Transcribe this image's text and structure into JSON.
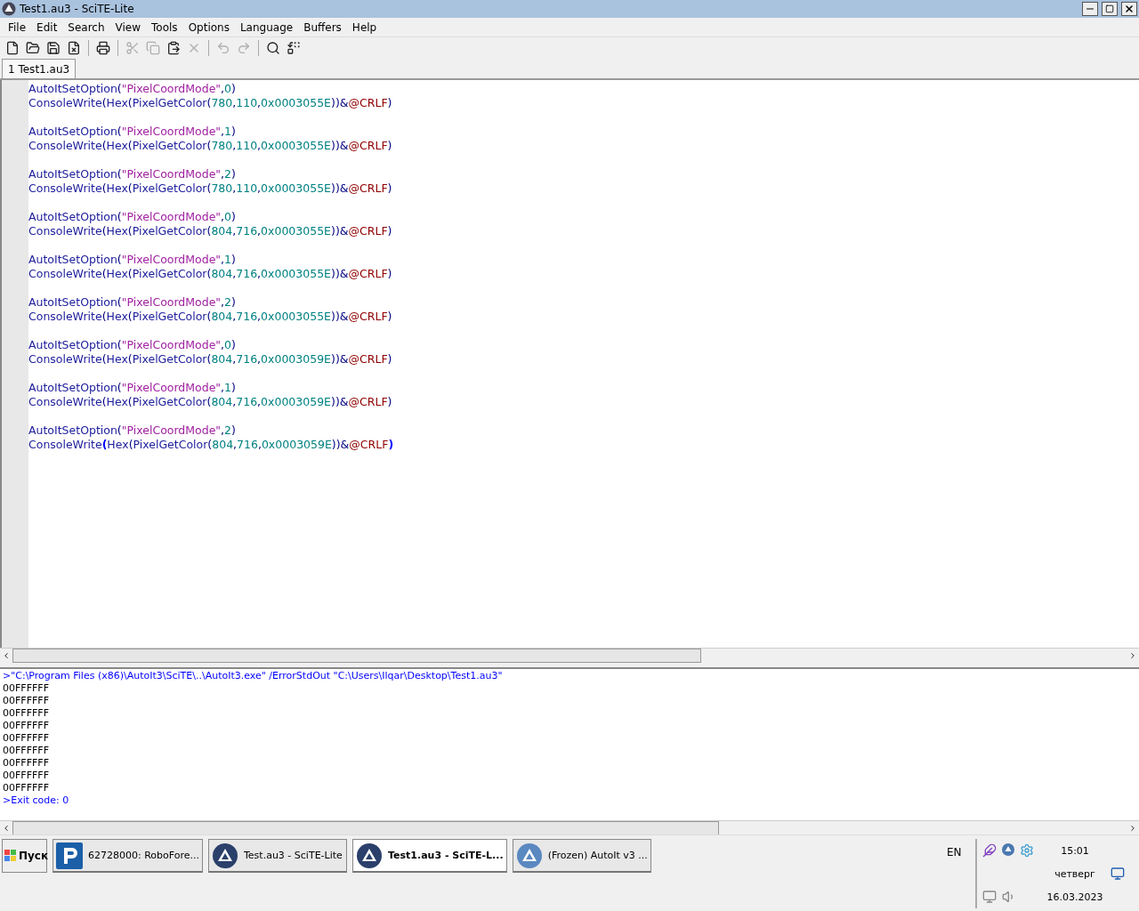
{
  "window": {
    "title": "Test1.au3 - SciTE-Lite"
  },
  "menu": [
    "File",
    "Edit",
    "Search",
    "View",
    "Tools",
    "Options",
    "Language",
    "Buffers",
    "Help"
  ],
  "toolbar": [
    {
      "kind": "new",
      "disabled": false
    },
    {
      "kind": "open",
      "disabled": false
    },
    {
      "kind": "save",
      "disabled": false
    },
    {
      "kind": "close",
      "disabled": false
    },
    {
      "kind": "sep"
    },
    {
      "kind": "print",
      "disabled": false
    },
    {
      "kind": "sep"
    },
    {
      "kind": "cut",
      "disabled": true
    },
    {
      "kind": "copy",
      "disabled": true
    },
    {
      "kind": "paste",
      "disabled": false
    },
    {
      "kind": "delete",
      "disabled": true
    },
    {
      "kind": "sep"
    },
    {
      "kind": "undo",
      "disabled": true
    },
    {
      "kind": "redo",
      "disabled": true
    },
    {
      "kind": "sep"
    },
    {
      "kind": "find",
      "disabled": false
    },
    {
      "kind": "replace",
      "disabled": false
    }
  ],
  "tabs": [
    {
      "label": "1 Test1.au3",
      "selected": true
    }
  ],
  "editor": {
    "blocks": [
      {
        "lines": [
          [
            {
              "text": "AutoItSetOption",
              "kind": "func"
            },
            {
              "text": "(",
              "kind": "op"
            },
            {
              "text": "\"PixelCoordMode\"",
              "kind": "string"
            },
            {
              "text": ",",
              "kind": "op"
            },
            {
              "text": "0",
              "kind": "number"
            },
            {
              "text": ")",
              "kind": "op"
            }
          ],
          [
            {
              "text": "ConsoleWrite",
              "kind": "func"
            },
            {
              "text": "(",
              "kind": "op"
            },
            {
              "text": "Hex",
              "kind": "func"
            },
            {
              "text": "(",
              "kind": "op"
            },
            {
              "text": "PixelGetColor",
              "kind": "func"
            },
            {
              "text": "(",
              "kind": "op"
            },
            {
              "text": "780",
              "kind": "number"
            },
            {
              "text": ",",
              "kind": "op"
            },
            {
              "text": "110",
              "kind": "number"
            },
            {
              "text": ",",
              "kind": "op"
            },
            {
              "text": "0x0003055E",
              "kind": "number"
            },
            {
              "text": "))&",
              "kind": "op"
            },
            {
              "text": "@CRLF",
              "kind": "macro"
            },
            {
              "text": ")",
              "kind": "op"
            }
          ]
        ]
      },
      {
        "lines": [
          [
            {
              "text": "AutoItSetOption",
              "kind": "func"
            },
            {
              "text": "(",
              "kind": "op"
            },
            {
              "text": "\"PixelCoordMode\"",
              "kind": "string"
            },
            {
              "text": ",",
              "kind": "op"
            },
            {
              "text": "1",
              "kind": "number"
            },
            {
              "text": ")",
              "kind": "op"
            }
          ],
          [
            {
              "text": "ConsoleWrite",
              "kind": "func"
            },
            {
              "text": "(",
              "kind": "op"
            },
            {
              "text": "Hex",
              "kind": "func"
            },
            {
              "text": "(",
              "kind": "op"
            },
            {
              "text": "PixelGetColor",
              "kind": "func"
            },
            {
              "text": "(",
              "kind": "op"
            },
            {
              "text": "780",
              "kind": "number"
            },
            {
              "text": ",",
              "kind": "op"
            },
            {
              "text": "110",
              "kind": "number"
            },
            {
              "text": ",",
              "kind": "op"
            },
            {
              "text": "0x0003055E",
              "kind": "number"
            },
            {
              "text": "))&",
              "kind": "op"
            },
            {
              "text": "@CRLF",
              "kind": "macro"
            },
            {
              "text": ")",
              "kind": "op"
            }
          ]
        ]
      },
      {
        "lines": [
          [
            {
              "text": "AutoItSetOption",
              "kind": "func"
            },
            {
              "text": "(",
              "kind": "op"
            },
            {
              "text": "\"PixelCoordMode\"",
              "kind": "string"
            },
            {
              "text": ",",
              "kind": "op"
            },
            {
              "text": "2",
              "kind": "number"
            },
            {
              "text": ")",
              "kind": "op"
            }
          ],
          [
            {
              "text": "ConsoleWrite",
              "kind": "func"
            },
            {
              "text": "(",
              "kind": "op"
            },
            {
              "text": "Hex",
              "kind": "func"
            },
            {
              "text": "(",
              "kind": "op"
            },
            {
              "text": "PixelGetColor",
              "kind": "func"
            },
            {
              "text": "(",
              "kind": "op"
            },
            {
              "text": "780",
              "kind": "number"
            },
            {
              "text": ",",
              "kind": "op"
            },
            {
              "text": "110",
              "kind": "number"
            },
            {
              "text": ",",
              "kind": "op"
            },
            {
              "text": "0x0003055E",
              "kind": "number"
            },
            {
              "text": "))&",
              "kind": "op"
            },
            {
              "text": "@CRLF",
              "kind": "macro"
            },
            {
              "text": ")",
              "kind": "op"
            }
          ]
        ]
      },
      {
        "lines": [
          [
            {
              "text": "AutoItSetOption",
              "kind": "func"
            },
            {
              "text": "(",
              "kind": "op"
            },
            {
              "text": "\"PixelCoordMode\"",
              "kind": "string"
            },
            {
              "text": ",",
              "kind": "op"
            },
            {
              "text": "0",
              "kind": "number"
            },
            {
              "text": ")",
              "kind": "op"
            }
          ],
          [
            {
              "text": "ConsoleWrite",
              "kind": "func"
            },
            {
              "text": "(",
              "kind": "op"
            },
            {
              "text": "Hex",
              "kind": "func"
            },
            {
              "text": "(",
              "kind": "op"
            },
            {
              "text": "PixelGetColor",
              "kind": "func"
            },
            {
              "text": "(",
              "kind": "op"
            },
            {
              "text": "804",
              "kind": "number"
            },
            {
              "text": ",",
              "kind": "op"
            },
            {
              "text": "716",
              "kind": "number"
            },
            {
              "text": ",",
              "kind": "op"
            },
            {
              "text": "0x0003055E",
              "kind": "number"
            },
            {
              "text": "))&",
              "kind": "op"
            },
            {
              "text": "@CRLF",
              "kind": "macro"
            },
            {
              "text": ")",
              "kind": "op"
            }
          ]
        ]
      },
      {
        "lines": [
          [
            {
              "text": "AutoItSetOption",
              "kind": "func"
            },
            {
              "text": "(",
              "kind": "op"
            },
            {
              "text": "\"PixelCoordMode\"",
              "kind": "string"
            },
            {
              "text": ",",
              "kind": "op"
            },
            {
              "text": "1",
              "kind": "number"
            },
            {
              "text": ")",
              "kind": "op"
            }
          ],
          [
            {
              "text": "ConsoleWrite",
              "kind": "func"
            },
            {
              "text": "(",
              "kind": "op"
            },
            {
              "text": "Hex",
              "kind": "func"
            },
            {
              "text": "(",
              "kind": "op"
            },
            {
              "text": "PixelGetColor",
              "kind": "func"
            },
            {
              "text": "(",
              "kind": "op"
            },
            {
              "text": "804",
              "kind": "number"
            },
            {
              "text": ",",
              "kind": "op"
            },
            {
              "text": "716",
              "kind": "number"
            },
            {
              "text": ",",
              "kind": "op"
            },
            {
              "text": "0x0003055E",
              "kind": "number"
            },
            {
              "text": "))&",
              "kind": "op"
            },
            {
              "text": "@CRLF",
              "kind": "macro"
            },
            {
              "text": ")",
              "kind": "op"
            }
          ]
        ]
      },
      {
        "lines": [
          [
            {
              "text": "AutoItSetOption",
              "kind": "func"
            },
            {
              "text": "(",
              "kind": "op"
            },
            {
              "text": "\"PixelCoordMode\"",
              "kind": "string"
            },
            {
              "text": ",",
              "kind": "op"
            },
            {
              "text": "2",
              "kind": "number"
            },
            {
              "text": ")",
              "kind": "op"
            }
          ],
          [
            {
              "text": "ConsoleWrite",
              "kind": "func"
            },
            {
              "text": "(",
              "kind": "op"
            },
            {
              "text": "Hex",
              "kind": "func"
            },
            {
              "text": "(",
              "kind": "op"
            },
            {
              "text": "PixelGetColor",
              "kind": "func"
            },
            {
              "text": "(",
              "kind": "op"
            },
            {
              "text": "804",
              "kind": "number"
            },
            {
              "text": ",",
              "kind": "op"
            },
            {
              "text": "716",
              "kind": "number"
            },
            {
              "text": ",",
              "kind": "op"
            },
            {
              "text": "0x0003055E",
              "kind": "number"
            },
            {
              "text": "))&",
              "kind": "op"
            },
            {
              "text": "@CRLF",
              "kind": "macro"
            },
            {
              "text": ")",
              "kind": "op"
            }
          ]
        ]
      },
      {
        "lines": [
          [
            {
              "text": "AutoItSetOption",
              "kind": "func"
            },
            {
              "text": "(",
              "kind": "op"
            },
            {
              "text": "\"PixelCoordMode\"",
              "kind": "string"
            },
            {
              "text": ",",
              "kind": "op"
            },
            {
              "text": "0",
              "kind": "number"
            },
            {
              "text": ")",
              "kind": "op"
            }
          ],
          [
            {
              "text": "ConsoleWrite",
              "kind": "func"
            },
            {
              "text": "(",
              "kind": "op"
            },
            {
              "text": "Hex",
              "kind": "func"
            },
            {
              "text": "(",
              "kind": "op"
            },
            {
              "text": "PixelGetColor",
              "kind": "func"
            },
            {
              "text": "(",
              "kind": "op"
            },
            {
              "text": "804",
              "kind": "number"
            },
            {
              "text": ",",
              "kind": "op"
            },
            {
              "text": "716",
              "kind": "number"
            },
            {
              "text": ",",
              "kind": "op"
            },
            {
              "text": "0x0003059E",
              "kind": "number"
            },
            {
              "text": "))&",
              "kind": "op"
            },
            {
              "text": "@CRLF",
              "kind": "macro"
            },
            {
              "text": ")",
              "kind": "op"
            }
          ]
        ]
      },
      {
        "lines": [
          [
            {
              "text": "AutoItSetOption",
              "kind": "func"
            },
            {
              "text": "(",
              "kind": "op"
            },
            {
              "text": "\"PixelCoordMode\"",
              "kind": "string"
            },
            {
              "text": ",",
              "kind": "op"
            },
            {
              "text": "1",
              "kind": "number"
            },
            {
              "text": ")",
              "kind": "op"
            }
          ],
          [
            {
              "text": "ConsoleWrite",
              "kind": "func"
            },
            {
              "text": "(",
              "kind": "op"
            },
            {
              "text": "Hex",
              "kind": "func"
            },
            {
              "text": "(",
              "kind": "op"
            },
            {
              "text": "PixelGetColor",
              "kind": "func"
            },
            {
              "text": "(",
              "kind": "op"
            },
            {
              "text": "804",
              "kind": "number"
            },
            {
              "text": ",",
              "kind": "op"
            },
            {
              "text": "716",
              "kind": "number"
            },
            {
              "text": ",",
              "kind": "op"
            },
            {
              "text": "0x0003059E",
              "kind": "number"
            },
            {
              "text": "))&",
              "kind": "op"
            },
            {
              "text": "@CRLF",
              "kind": "macro"
            },
            {
              "text": ")",
              "kind": "op"
            }
          ]
        ]
      },
      {
        "lines": [
          [
            {
              "text": "AutoItSetOption",
              "kind": "func"
            },
            {
              "text": "(",
              "kind": "op"
            },
            {
              "text": "\"PixelCoordMode\"",
              "kind": "string"
            },
            {
              "text": ",",
              "kind": "op"
            },
            {
              "text": "2",
              "kind": "number"
            },
            {
              "text": ")",
              "kind": "op"
            }
          ],
          [
            {
              "text": "ConsoleWrite",
              "kind": "func"
            },
            {
              "text": "(",
              "kind": "brace"
            },
            {
              "text": "Hex",
              "kind": "func"
            },
            {
              "text": "(",
              "kind": "op"
            },
            {
              "text": "PixelGetColor",
              "kind": "func"
            },
            {
              "text": "(",
              "kind": "op"
            },
            {
              "text": "804",
              "kind": "number"
            },
            {
              "text": ",",
              "kind": "op"
            },
            {
              "text": "716",
              "kind": "number"
            },
            {
              "text": ",",
              "kind": "op"
            },
            {
              "text": "0x0003059E",
              "kind": "number"
            },
            {
              "text": "))&",
              "kind": "op"
            },
            {
              "text": "@CRLF",
              "kind": "macro"
            },
            {
              "text": ")",
              "kind": "brace"
            }
          ]
        ]
      }
    ]
  },
  "output": [
    {
      "text": ">\"C:\\Program Files (x86)\\AutoIt3\\SciTE\\..\\AutoIt3.exe\" /ErrorStdOut \"C:\\Users\\Ilqar\\Desktop\\Test1.au3\"",
      "kind": "info"
    },
    {
      "text": "00FFFFFF",
      "kind": "plain"
    },
    {
      "text": "00FFFFFF",
      "kind": "plain"
    },
    {
      "text": "00FFFFFF",
      "kind": "plain"
    },
    {
      "text": "00FFFFFF",
      "kind": "plain"
    },
    {
      "text": "00FFFFFF",
      "kind": "plain"
    },
    {
      "text": "00FFFFFF",
      "kind": "plain"
    },
    {
      "text": "00FFFFFF",
      "kind": "plain"
    },
    {
      "text": "00FFFFFF",
      "kind": "plain"
    },
    {
      "text": "00FFFFFF",
      "kind": "plain"
    },
    {
      "text": ">Exit code: 0",
      "kind": "info"
    }
  ],
  "taskbar": {
    "start": "Пуск",
    "tasks": [
      {
        "label": "62728000: RoboFore...",
        "kind": "robo",
        "selected": false
      },
      {
        "label": "Test.au3 - SciTE-Lite",
        "kind": "scite",
        "selected": false
      },
      {
        "label": "Test1.au3 - SciTE-L...",
        "kind": "scite",
        "selected": true
      },
      {
        "label": "(Frozen) AutoIt v3 ...",
        "kind": "autoit",
        "selected": false
      }
    ],
    "language": "EN",
    "time": "15:01",
    "day": "четверг",
    "date": "16.03.2023"
  }
}
